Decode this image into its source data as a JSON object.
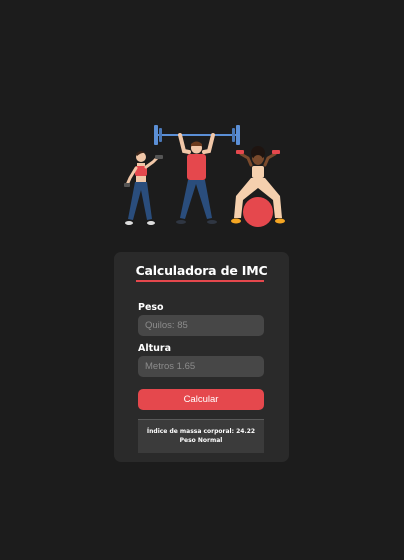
{
  "illustration": {
    "icon": "fitness-people-illustration",
    "colors": {
      "skin_light": "#f1c7a8",
      "skin_dark": "#7a4a2c",
      "top_red": "#e5484d",
      "pants_blue": "#2a4d7c",
      "weights_blue": "#5b8fd6",
      "ball_red": "#e5484d",
      "shoes_orange": "#f5a623"
    }
  },
  "calculator": {
    "title": "Calculadora de IMC",
    "weight_label": "Peso",
    "weight_placeholder": "Quilos: 85",
    "height_label": "Altura",
    "height_placeholder": "Metros 1.65",
    "button_label": "Calcular",
    "result_line1": "Índice de massa corporal: 24.22",
    "result_line2": "Peso Normal"
  },
  "colors": {
    "background": "#1c1c1c",
    "card": "#2a2a2a",
    "input": "#474747",
    "accent": "#e5484d"
  }
}
